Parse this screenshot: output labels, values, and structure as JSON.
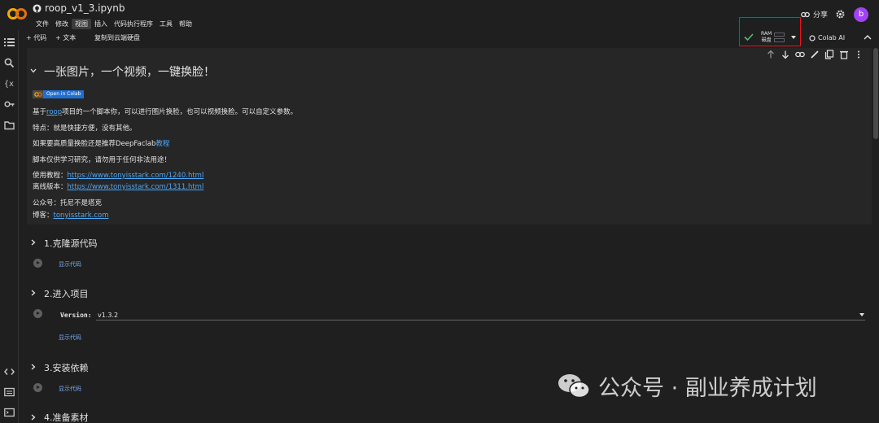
{
  "header": {
    "notebook_title": "roop_v1_3.ipynb",
    "menus": [
      "文件",
      "修改",
      "视图",
      "插入",
      "代码执行程序",
      "工具",
      "帮助"
    ],
    "active_menu_index": 2,
    "share_label": "分享",
    "avatar_letter": "b"
  },
  "toolbar": {
    "add_code": "+ 代码",
    "add_text": "+ 文本",
    "copy_drive": "复制到云端硬盘",
    "ram_label": "RAM",
    "disk_label": "磁盘",
    "colab_ai": "Colab AI"
  },
  "text_cell": {
    "heading": "一张图片，一个视频，一键换脸！",
    "badge": "Open in Colab",
    "p1_prefix": "基于",
    "p1_link": "roop",
    "p1_suffix": "项目的一个脚本你，可以进行图片换脸，也可以视频换脸。可以自定义参数。",
    "p2": "特点：就是快捷方便，没有其他。",
    "p3_prefix": "如果要高质量换脸还是推荐DeepFaclab",
    "p3_link": "教程",
    "p4": "脚本仅供学习研究，请勿用于任何非法用途！",
    "tutorial_label": "使用教程：",
    "tutorial_url": "https://www.tonyisstark.com/1240.html",
    "offline_label": "离线版本：",
    "offline_url": "https://www.tonyisstark.com/1311.html",
    "wechat": "公众号：托尼不是塔克",
    "blog_label": "博客：",
    "blog_url": "tonyisstark.com"
  },
  "sections": [
    {
      "title": "1.克隆源代码",
      "show_code": "显示代码"
    },
    {
      "title": "2.进入项目",
      "show_code": "显示代码",
      "param_label": "Version:",
      "param_value": "v1.3.2"
    },
    {
      "title": "3.安装依赖",
      "show_code": "显示代码"
    },
    {
      "title": "4.准备素材"
    }
  ],
  "watermark": "公众号 · 副业养成计划",
  "colors": {
    "background": "#1f1f1f",
    "cell_background": "#262626",
    "link": "#4ea7f4",
    "highlight_box": "#e8141b",
    "avatar": "#a142f4"
  }
}
